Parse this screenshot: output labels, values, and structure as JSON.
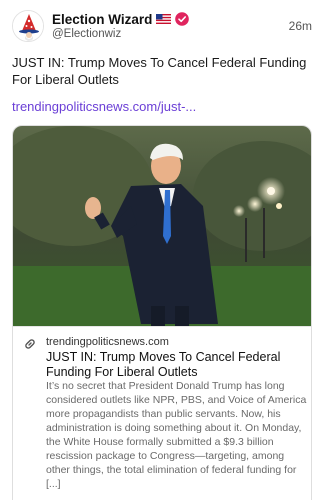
{
  "post": {
    "author": {
      "display_name": "Election Wizard",
      "handle": "@Electionwiz",
      "flag_icon": "us-flag-icon",
      "verified_icon": "verified-badge-icon",
      "verified_color": "#e0245e"
    },
    "timestamp": "26m",
    "text": "JUST IN: Trump Moves To Cancel Federal Funding For Liberal Outlets",
    "link_text": "trendingpoliticsnews.com/just-...",
    "link_color": "#6b3fd6",
    "card": {
      "link_icon": "link-icon",
      "domain": "trendingpoliticsnews.com",
      "title": "JUST IN: Trump Moves To Cancel Federal Funding For Liberal Outlets",
      "description": "It’s no secret that President Donald Trump has long considered outlets like NPR, PBS, and Voice of America more propagandists than public servants. Now, his administration is doing something about it. On Monday, the White House formally submitted a $9.3 billion rescission package to Congress—targeting, among other things, the total elimination of federal funding for [...]"
    }
  }
}
